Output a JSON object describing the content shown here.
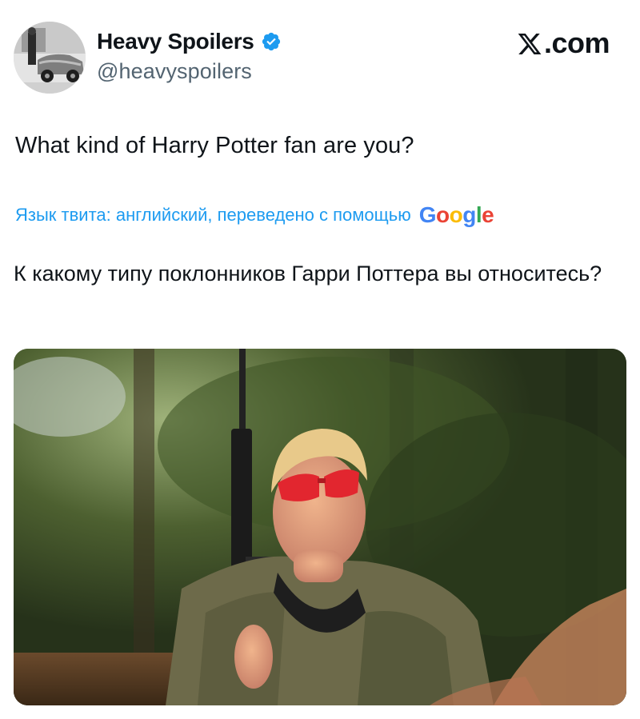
{
  "author": {
    "display_name": "Heavy Spoilers",
    "handle": "@heavyspoilers",
    "verified": true,
    "verified_color": "#1d9bf0"
  },
  "brand": {
    "label": ".com"
  },
  "tweet": {
    "text": "What kind of Harry Potter fan are you?"
  },
  "translation": {
    "note": "Язык твита: английский, переведено с помощью",
    "provider_logo": "Google",
    "text": "К какому типу поклонников Гарри Поттера вы относитесь?"
  },
  "media": {
    "kind": "photo"
  },
  "colors": {
    "link": "#1d9bf0",
    "text": "#0f1419",
    "secondary_text": "#536471"
  },
  "icons": [
    "avatar-photo",
    "verified-badge-icon",
    "x-logo-icon",
    "google-logo"
  ]
}
